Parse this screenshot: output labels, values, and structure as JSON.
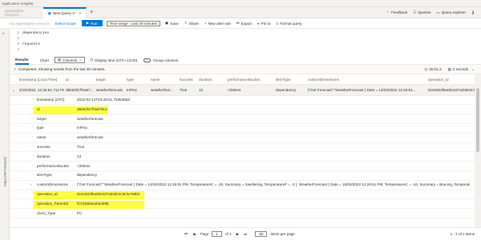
{
  "app_title": "Application Insights",
  "tabs": {
    "resource": "appinsights-resource",
    "query": "New Query 1*",
    "add": "+"
  },
  "header_actions": {
    "feedback": "Feedback",
    "queries": "Queries",
    "query_explorer": "Query explorer"
  },
  "toolbar": {
    "scope_resource": "my-appinsights-resource",
    "select_scope": "Select scope",
    "run": "Run",
    "time_range": "Time range : Last 30 minutes",
    "save": "Save",
    "share": "Share",
    "new_alert": "New alert rule",
    "export": "Export",
    "pin": "Pin to",
    "format": "Format query"
  },
  "editor": {
    "lines": [
      {
        "no": "1",
        "text": "dependencies"
      },
      {
        "no": "2",
        "text": ""
      },
      {
        "no": "3",
        "text": "requests"
      },
      {
        "no": "4",
        "text": ""
      }
    ]
  },
  "results_tabs": {
    "results": "Results",
    "chart": "Chart",
    "columns": "Columns",
    "display_time": "Display time (UTC+13:00)",
    "group_columns": "Group columns"
  },
  "status": {
    "text": "Completed. Showing results from the last 30 minutes.",
    "duration": "00:01.3",
    "records": "2 records"
  },
  "columns": [
    "timestamp [Local Time]",
    "id",
    "target",
    "type",
    "name",
    "success",
    "duration",
    "performanceBucket",
    "itemType",
    "customDimensions",
    "operation_Id"
  ],
  "row": [
    "2/15/2022, 12:26:51.712 PM",
    "d5b62f47f0a87...",
    "weatherforecast",
    "InProc",
    "weatherfore...",
    "True",
    "13",
    "<250ms",
    "dependency",
    "{\"Get Forecast\":\"WeatherForecast { Date = 14/02/2022 12:26:51...",
    "515cb03f5a0bc637ad3d22c9cfa..."
  ],
  "details": [
    {
      "key": "timestamp [UTC]",
      "value": "2022-02-12T23:26:51.7535355Z",
      "highlight": false
    },
    {
      "key": "id",
      "value": "d5b62f47f0a87bce",
      "highlight": true
    },
    {
      "key": "target",
      "value": "weatherforecast",
      "highlight": false
    },
    {
      "key": "type",
      "value": "InProc",
      "highlight": false
    },
    {
      "key": "name",
      "value": "weatherforecast",
      "highlight": false
    },
    {
      "key": "success",
      "value": "True",
      "highlight": false
    },
    {
      "key": "duration",
      "value": "13",
      "highlight": false
    },
    {
      "key": "performanceBucket",
      "value": "<250ms",
      "highlight": false
    },
    {
      "key": "itemType",
      "value": "dependency",
      "highlight": false
    },
    {
      "key": "customDimensions",
      "value": "{\"Get Forecast\":\"WeatherForecast { Date = 14/02/2022 12:26:51 PM, TemperatureC = -20, Summary = Sweltering, TemperatureF = -3 }, WeatherForecast { Date = 15/02/2022 12:26:51 PM, TemperatureC = -16, Summary = Bracing, TemperatureF = 4 }, WeatherFor",
      "highlight": false
    },
    {
      "key": "operation_Id",
      "value": "515cb03f5a0bc637ad3d22c9cfa769b0",
      "highlight": true
    },
    {
      "key": "operation_ParentId",
      "value": "f07d48bba4b84998",
      "highlight": true
    },
    {
      "key": "client_Type",
      "value": "PC",
      "highlight": false
    }
  ],
  "pager": {
    "page_label": "Page",
    "page": "1",
    "of": "of 1",
    "per_page": "50",
    "items_per_page": "items per page",
    "range": "1 - 2 of 2 items"
  },
  "side_panel": "Schema and Filter",
  "colors": {
    "accent": "#0078d4",
    "highlight": "#ffff3d"
  }
}
